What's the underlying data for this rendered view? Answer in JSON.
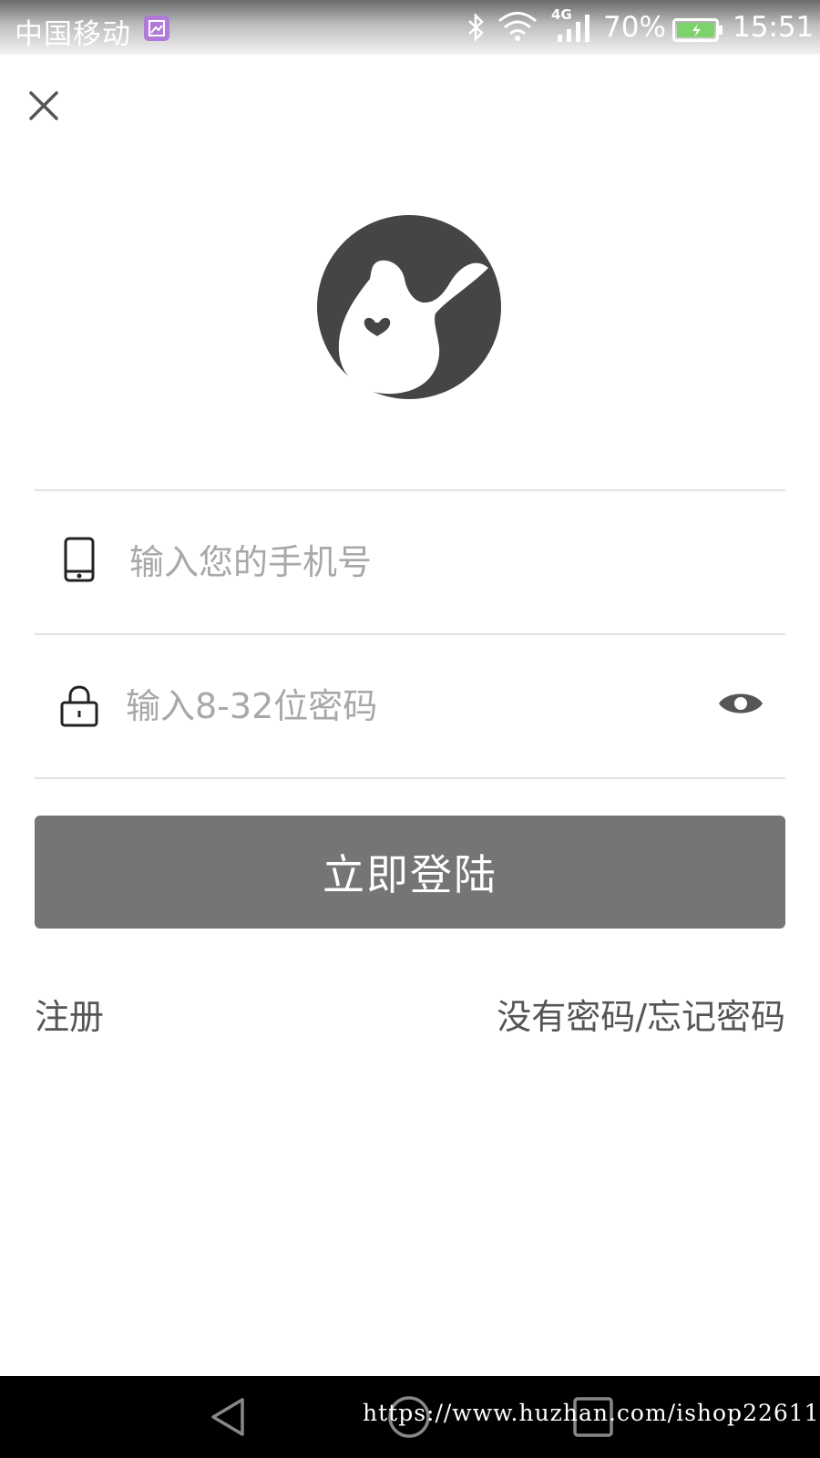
{
  "status_bar": {
    "carrier": "中国移动",
    "network": "4G",
    "battery_percent": "70%",
    "time": "15:51",
    "app_icon": "gallery-icon"
  },
  "header": {
    "close_icon": "close-icon"
  },
  "logo": {
    "icon": "rabbit-heart-logo"
  },
  "form": {
    "phone": {
      "icon": "phone-icon",
      "placeholder": "输入您的手机号",
      "value": ""
    },
    "password": {
      "icon": "lock-icon",
      "placeholder": "输入8-32位密码",
      "value": "",
      "toggle_icon": "eye-icon"
    },
    "submit_label": "立即登陆"
  },
  "links": {
    "register": "注册",
    "forgot": "没有密码/忘记密码"
  },
  "nav_bar": {
    "back_icon": "back-triangle-icon",
    "home_icon": "home-circle-icon",
    "recent_icon": "recent-square-icon",
    "watermark": "https://www.huzhan.com/ishop22611"
  },
  "colors": {
    "button": "#757575",
    "icon": "#444444",
    "placeholder": "#a8a8a8",
    "divider": "#e3e3e3",
    "battery": "#7cd36b"
  }
}
